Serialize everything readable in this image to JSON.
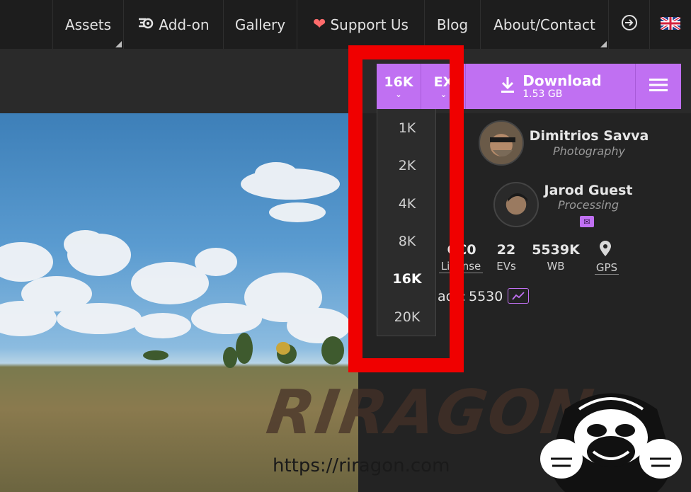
{
  "nav": {
    "items": [
      {
        "label": "Assets"
      },
      {
        "label": "Add-on"
      },
      {
        "label": "Gallery"
      },
      {
        "label": "Support Us"
      },
      {
        "label": "Blog"
      },
      {
        "label": "About/Contact"
      }
    ],
    "login_icon": "login-icon",
    "language_icon": "uk-flag-icon"
  },
  "download_bar": {
    "resolution": "16K",
    "format": "EX",
    "download_label": "Download",
    "download_size": "1.53 GB",
    "menu_icon": "hamburger-icon",
    "accent": "#c070f2"
  },
  "resolution_dropdown": {
    "options": [
      "1K",
      "2K",
      "4K",
      "8K",
      "16K",
      "20K"
    ],
    "selected": "16K"
  },
  "authors": [
    {
      "name": "Dimitrios Savva",
      "role": "Photography"
    },
    {
      "name": "Jarod Guest",
      "role": "Processing"
    }
  ],
  "stats": [
    {
      "value": "CC0",
      "label": "License"
    },
    {
      "value": "22",
      "label": "EVs"
    },
    {
      "value": "5539K",
      "label": "WB"
    },
    {
      "value": "",
      "label": "GPS"
    }
  ],
  "downloads": {
    "label_fragment": "ads:",
    "count": "5530"
  },
  "partial_label": ":",
  "watermark": {
    "brand": "RIRAGON",
    "url": "https://riragon.com"
  },
  "highlight_color": "#f00000"
}
